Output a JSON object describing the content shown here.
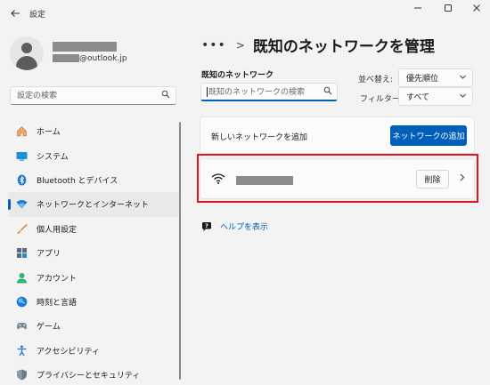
{
  "window": {
    "title": "設定",
    "back_icon": "back-arrow-icon"
  },
  "profile": {
    "email_suffix": "@outlook.jp"
  },
  "sidebar": {
    "search_placeholder": "設定の検索",
    "items": [
      {
        "label": "ホーム",
        "icon": "home-icon",
        "active": false
      },
      {
        "label": "システム",
        "icon": "system-icon",
        "active": false
      },
      {
        "label": "Bluetooth とデバイス",
        "icon": "bluetooth-icon",
        "active": false
      },
      {
        "label": "ネットワークとインターネット",
        "icon": "network-icon",
        "active": true
      },
      {
        "label": "個人用設定",
        "icon": "brush-icon",
        "active": false
      },
      {
        "label": "アプリ",
        "icon": "apps-icon",
        "active": false
      },
      {
        "label": "アカウント",
        "icon": "account-icon",
        "active": false
      },
      {
        "label": "時刻と言語",
        "icon": "time-language-icon",
        "active": false
      },
      {
        "label": "ゲーム",
        "icon": "gaming-icon",
        "active": false
      },
      {
        "label": "アクセシビリティ",
        "icon": "accessibility-icon",
        "active": false
      },
      {
        "label": "プライバシーとセキュリティ",
        "icon": "shield-icon",
        "active": false
      }
    ]
  },
  "header": {
    "breadcrumb_more": "•••",
    "breadcrumb_sep": ">",
    "title": "既知のネットワークを管理"
  },
  "known": {
    "section_label": "既知のネットワーク",
    "search_placeholder": "既知のネットワークの検索",
    "sort_label": "並べ替え:",
    "sort_value": "優先順位",
    "filter_label": "フィルター:",
    "filter_value": "すべて"
  },
  "add_network": {
    "label": "新しいネットワークを追加",
    "button": "ネットワークの追加"
  },
  "network_item": {
    "delete_button": "削除"
  },
  "help": {
    "link": "ヘルプを表示"
  },
  "colors": {
    "accent": "#005fb8",
    "highlight": "#e0141e",
    "background": "#f3f3f3",
    "card": "#fbfbfb"
  }
}
